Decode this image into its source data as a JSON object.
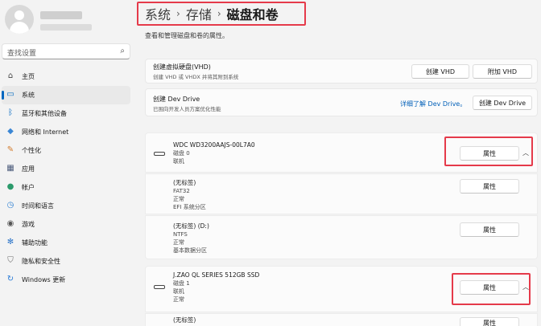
{
  "sidebar": {
    "search_placeholder": "查找设置",
    "items": [
      {
        "label": "主页",
        "icon": "home-icon",
        "glyph": "⌂",
        "color": "#444444"
      },
      {
        "label": "系统",
        "icon": "system-icon",
        "glyph": "▭",
        "color": "#0067c0",
        "active": true
      },
      {
        "label": "蓝牙和其他设备",
        "icon": "bluetooth-icon",
        "glyph": "ᛒ",
        "color": "#0067c0"
      },
      {
        "label": "网络和 Internet",
        "icon": "wifi-icon",
        "glyph": "◆",
        "color": "#3a86d4"
      },
      {
        "label": "个性化",
        "icon": "brush-icon",
        "glyph": "✎",
        "color": "#d27a2a"
      },
      {
        "label": "应用",
        "icon": "apps-icon",
        "glyph": "▦",
        "color": "#4a5a7a"
      },
      {
        "label": "帐户",
        "icon": "account-icon",
        "glyph": "●",
        "color": "#2b9a6b"
      },
      {
        "label": "时间和语言",
        "icon": "clock-icon",
        "glyph": "◷",
        "color": "#2d7fd2"
      },
      {
        "label": "游戏",
        "icon": "game-icon",
        "glyph": "◉",
        "color": "#555555"
      },
      {
        "label": "辅助功能",
        "icon": "accessibility-icon",
        "glyph": "✻",
        "color": "#2b74c9"
      },
      {
        "label": "隐私和安全性",
        "icon": "shield-icon",
        "glyph": "⛉",
        "color": "#6a6a6a"
      },
      {
        "label": "Windows 更新",
        "icon": "update-icon",
        "glyph": "↻",
        "color": "#2a7bd6"
      }
    ]
  },
  "breadcrumb": {
    "b1": "系统",
    "b2": "存储",
    "b3": "磁盘和卷",
    "sep": "›"
  },
  "description": "查看和管理磁盘和卷的属性。",
  "vhd": {
    "title": "创建虚拟硬盘(VHD)",
    "sub": "创建 VHD 或 VHDX 并将其附到系统",
    "create": "创建 VHD",
    "attach": "附加 VHD"
  },
  "devdrive": {
    "title": "创建 Dev Drive",
    "sub": "已围向开发人员方案优化性能",
    "link": "详细了解 Dev Drive。",
    "button": "创建 Dev Drive"
  },
  "properties_label": "属性",
  "disk0": {
    "name": "WDC WD3200AAJS-00L7A0",
    "number": "磁盘 0",
    "status": "联机"
  },
  "vol0": {
    "name": "(无标签)",
    "fs": "FAT32",
    "health": "正常",
    "type": "EFI 系统分区"
  },
  "vol1": {
    "name": "(无标签) (D:)",
    "fs": "NTFS",
    "health": "正常",
    "type": "基本数据分区"
  },
  "disk1": {
    "name": "J.ZAO QL SERIES 512GB SSD",
    "number": "磁盘 1",
    "status": "联机",
    "health": "正常"
  },
  "vol2": {
    "name": "(无标签)"
  },
  "icons": {
    "search": "search-icon",
    "chevron": "chevron-up-icon",
    "disk": "disk-icon"
  }
}
